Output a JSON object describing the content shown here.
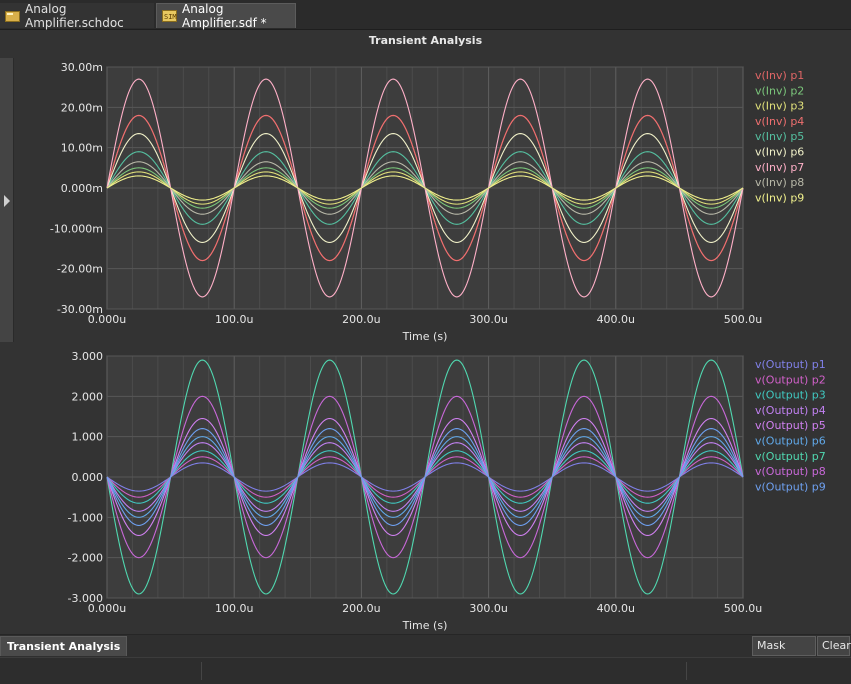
{
  "tabs": [
    {
      "label": "Analog Amplifier.schdoc",
      "active": false,
      "icon": "schematic-doc-icon"
    },
    {
      "label": "Analog Amplifier.sdf *",
      "active": true,
      "icon": "simulation-doc-icon"
    }
  ],
  "panel_title": "Transient Analysis",
  "bottom_tab": "Transient Analysis",
  "buttons": {
    "mask_level": "Mask Level",
    "clear": "Clear"
  },
  "colors": {
    "background": "#333333",
    "plot_bg": "#3d3d3d",
    "grid": "#575757",
    "axis_text": "#e6e6e6"
  },
  "chart_data": [
    {
      "type": "line",
      "title": "",
      "xlabel": "Time (s)",
      "ylabel": "",
      "xlim": [
        0,
        500
      ],
      "ylim": [
        -30,
        30
      ],
      "x_ticks": [
        0,
        100,
        200,
        300,
        400,
        500
      ],
      "x_tick_labels": [
        "0.000u",
        "100.0u",
        "200.0u",
        "300.0u",
        "400.0u",
        "500.0u"
      ],
      "y_ticks": [
        30,
        20,
        10,
        0,
        -10,
        -20,
        -30
      ],
      "y_tick_labels": [
        "30.00m",
        "20.00m",
        "10.00m",
        "0.000m",
        "-10.000m",
        "-20.00m",
        "-30.00m"
      ],
      "grid": true,
      "legend_position": "right",
      "waveform": {
        "shape": "sine",
        "frequency_khz": 10,
        "phase": "positive"
      },
      "series": [
        {
          "name": "v(Inv) p1",
          "color": "#e06666",
          "amplitude": 18
        },
        {
          "name": "v(Inv) p2",
          "color": "#7bc67b",
          "amplitude": 5
        },
        {
          "name": "v(Inv) p3",
          "color": "#e0e07a",
          "amplitude": 4
        },
        {
          "name": "v(Inv) p4",
          "color": "#ee6f6f",
          "amplitude": 18
        },
        {
          "name": "v(Inv) p5",
          "color": "#55c0a0",
          "amplitude": 9
        },
        {
          "name": "v(Inv) p6",
          "color": "#f0f0c8",
          "amplitude": 13.5
        },
        {
          "name": "v(Inv) p7",
          "color": "#ffb0c8",
          "amplitude": 27
        },
        {
          "name": "v(Inv) p8",
          "color": "#b8b8a8",
          "amplitude": 6.5
        },
        {
          "name": "v(Inv) p9",
          "color": "#f0f08c",
          "amplitude": 3
        }
      ]
    },
    {
      "type": "line",
      "title": "",
      "xlabel": "Time (s)",
      "ylabel": "",
      "xlim": [
        0,
        500
      ],
      "ylim": [
        -3,
        3
      ],
      "x_ticks": [
        0,
        100,
        200,
        300,
        400,
        500
      ],
      "x_tick_labels": [
        "0.000u",
        "100.0u",
        "200.0u",
        "300.0u",
        "400.0u",
        "500.0u"
      ],
      "y_ticks": [
        3,
        2,
        1,
        0,
        -1,
        -2,
        -3
      ],
      "y_tick_labels": [
        "3.000",
        "2.000",
        "1.000",
        "0.000",
        "-1.000",
        "-2.000",
        "-3.000"
      ],
      "grid": true,
      "legend_position": "right",
      "waveform": {
        "shape": "sine",
        "frequency_khz": 10,
        "phase": "negative"
      },
      "series": [
        {
          "name": "v(Output) p1",
          "color": "#8080e8",
          "amplitude": 0.35
        },
        {
          "name": "v(Output) p2",
          "color": "#d060c8",
          "amplitude": 0.5
        },
        {
          "name": "v(Output) p3",
          "color": "#40c8c0",
          "amplitude": 0.65
        },
        {
          "name": "v(Output) p4",
          "color": "#c080f0",
          "amplitude": 0.85
        },
        {
          "name": "v(Output) p5",
          "color": "#d080f0",
          "amplitude": 1.45
        },
        {
          "name": "v(Output) p6",
          "color": "#60a8e8",
          "amplitude": 1.0
        },
        {
          "name": "v(Output) p7",
          "color": "#50d8b0",
          "amplitude": 2.9
        },
        {
          "name": "v(Output) p8",
          "color": "#c868d8",
          "amplitude": 2.0
        },
        {
          "name": "v(Output) p9",
          "color": "#6ea0f0",
          "amplitude": 1.2
        }
      ]
    }
  ]
}
